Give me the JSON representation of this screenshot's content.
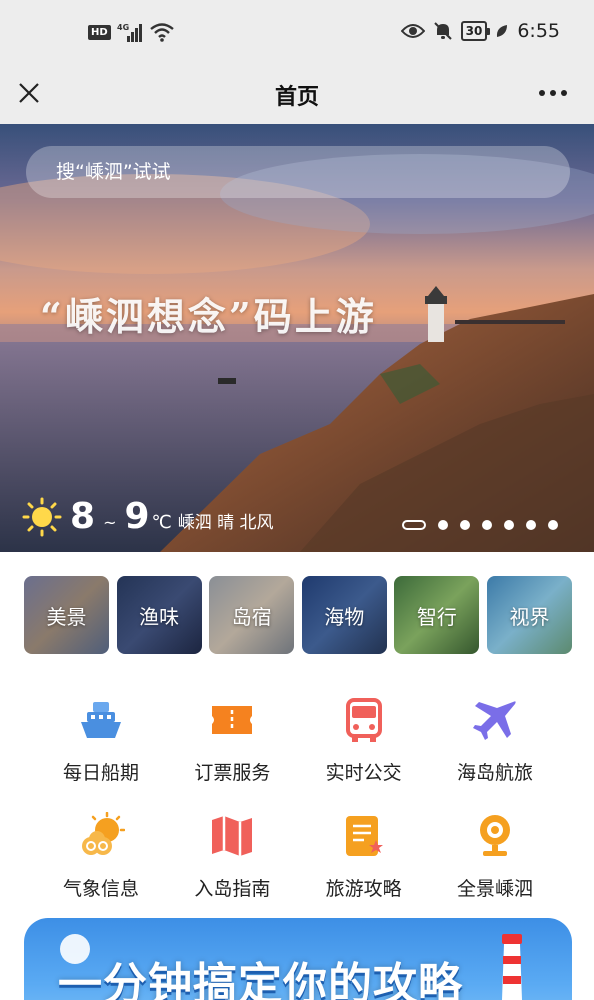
{
  "status_bar": {
    "network_badge": "HD",
    "network_type": "4G",
    "battery": "30",
    "time": "6:55"
  },
  "nav": {
    "title": "首页"
  },
  "banner": {
    "search_placeholder": "搜“嵊泗”试试",
    "slogan": "“嵊泗想念”码上游",
    "weather": {
      "temp_low": "8",
      "separator": "~",
      "temp_high": "9",
      "unit": "℃",
      "description": "嵊泗 晴 北风"
    },
    "carousel": {
      "total": 7,
      "active_index": 0
    }
  },
  "categories": [
    {
      "label": "美景"
    },
    {
      "label": "渔味"
    },
    {
      "label": "岛宿"
    },
    {
      "label": "海物"
    },
    {
      "label": "智行"
    },
    {
      "label": "视界"
    }
  ],
  "services": [
    [
      {
        "label": "每日船期",
        "icon": "ship-icon"
      },
      {
        "label": "订票服务",
        "icon": "ticket-icon"
      },
      {
        "label": "实时公交",
        "icon": "bus-icon"
      },
      {
        "label": "海岛航旅",
        "icon": "airplane-icon"
      }
    ],
    [
      {
        "label": "气象信息",
        "icon": "weather-icon"
      },
      {
        "label": "入岛指南",
        "icon": "map-icon"
      },
      {
        "label": "旅游攻略",
        "icon": "guide-icon"
      },
      {
        "label": "全景嵊泗",
        "icon": "panorama-camera-icon"
      }
    ]
  ],
  "promo": {
    "title": "一分钟搞定你的攻略"
  },
  "colors": {
    "chrome_bg": "#ededed",
    "ship_blue": "#4a8fe0",
    "ticket_orange": "#f5821f",
    "bus_red": "#f0605a",
    "plane_purple": "#7a6ee8",
    "weather_orange": "#f5a020",
    "map_red": "#f0605a",
    "guide_orange": "#f5a020",
    "camera_orange": "#f5a020",
    "promo_blue": "#3d8fe6"
  }
}
